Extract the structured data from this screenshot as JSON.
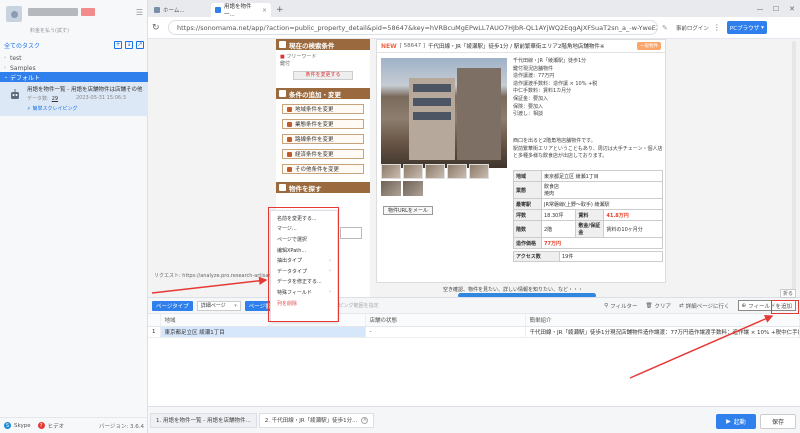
{
  "sidebar": {
    "user_sub": "料金を払う(試す)",
    "task_head_label": "全てのタスク",
    "tree": [
      {
        "label": "test"
      },
      {
        "label": "Samples"
      },
      {
        "label": "デフォルト"
      }
    ],
    "task": {
      "title": "用語を物件一覧 - 用語を店舗物件は店舗その他",
      "data_label": "データ数:",
      "data_count": "29",
      "date": "2023-05-31 15:06:3",
      "action": "簡単スクレイピング"
    },
    "footer": {
      "skype": "Skype",
      "help": "ヒデオ",
      "version": "バージョン: 3.6.4"
    }
  },
  "tabs": [
    {
      "label": "ホーム..."
    },
    {
      "label": "用語を物件一..."
    }
  ],
  "address": {
    "url": "https://sonomama.net/app/?action=public_property_detail&pid=58647&key=hVRBcuMgEPwLL7AUO7HJbR-QL1AYjWQ2EqgAJXFSuaT2sn_a_-w-YweEZMCuyg...",
    "login": "事前ログイン",
    "browser_btn": "PCブラウザ"
  },
  "webpage": {
    "cond_head": "現在の検索条件",
    "cond_line1": "フリーワード",
    "cond_line2": "鍵付",
    "cond_btn": "条件を変更する",
    "add_head": "条件の追加・変更",
    "change_btns": [
      "地域条件を変更",
      "業態条件を変更",
      "路線条件を変更",
      "経済条件を変更",
      "その他条件を変更"
    ],
    "find_head": "物件を探す",
    "new_label": "NEW",
    "property_id": "[ 58647 ]",
    "property_title": "千代田線・JR「綾瀬駅」徒歩1分 / 駅前繁華街エリア2階角地店舗物件※",
    "badge": "一般物件",
    "desc_lines": [
      "千代田線・JR「綾瀬駅」徒歩1分",
      "鍵付現況店舗物件",
      "造作讓渡：77万円",
      "造作讓渡手数料：造作讓 × 10% +税",
      "中仁手数料：賃料1カ月分",
      "保証金：要加入",
      "保険：要加入",
      "引渡し：相談"
    ],
    "desc2_lines": [
      "西口を出ると2階角地店舗物件です。",
      "駅前繁華街エリアということもあり、周辺は大手チェーン・個人店",
      "と多種多様な飲食店が出店しております。"
    ],
    "url_btn": "物件URLをメール",
    "table": {
      "area_label": "地域",
      "area_value": "東京都足立区 綾瀬1丁目",
      "biz_label": "業態",
      "biz_value1": "飲食店",
      "biz_value2": "焼肉",
      "station_label": "最寄駅",
      "station_value": "JR常磐線(上野〜取手) 綾瀬駅",
      "tsubo_label": "坪数",
      "tsubo_value": "18.30坪",
      "rent_label": "賃料",
      "rent_value": "41.8万円",
      "floor_label": "階数",
      "floor_value": "2階",
      "deposit_label": "敷金/保証金",
      "deposit_value": "賃料の10ヶ月分",
      "transfer_label": "造作価格",
      "transfer_value": "77万円",
      "access_label": "アクセス数",
      "access_value": "19件"
    },
    "bottom_text": "空き確認、物件を見たい、詳しい情報を知りたい、など・・・",
    "left_line": "リクエスト: https://analyze.pro.research-artisan.com/..."
  },
  "context_menu": {
    "items": [
      {
        "label": "名前を変更する...",
        "sub": false,
        "danger": false
      },
      {
        "label": "マージ...",
        "sub": false,
        "danger": false
      },
      {
        "label": "ページで選択",
        "sub": false,
        "danger": false
      },
      {
        "label": "编辑XPath...",
        "sub": false,
        "danger": false
      },
      {
        "label": "抽出タイプ",
        "sub": true,
        "danger": false
      },
      {
        "label": "データタイプ",
        "sub": true,
        "danger": false
      },
      {
        "label": "データを修正する...",
        "sub": false,
        "danger": false
      },
      {
        "label": "特殊フィールド",
        "sub": true,
        "danger": false
      },
      {
        "label": "列を削除",
        "sub": false,
        "danger": true
      }
    ]
  },
  "datapanel": {
    "page_type_btn": "ページタイプ",
    "page_type_select": "詳細ページ",
    "page_no_btn": "ページ番号",
    "crawl_label": "スクレイピング範囲を指定",
    "filter": "フィルター",
    "clear": "クリア",
    "detail_go": "詳細ページに行く",
    "add_field": "フィールドを追加",
    "back_top": "折る",
    "columns": [
      "地域",
      "店舗の状態",
      "簡単紹介"
    ],
    "rows": [
      {
        "no": "1",
        "area": "東京都足立区 綾瀬1丁目",
        "status": "-",
        "intro": "千代田線・JR「綾瀬駅」徒歩1分現況店舗物件造作讓渡：77万円造作讓渡手数料：造作讓 × 10% +税中仁手数料：賃料1カ月分..."
      }
    ]
  },
  "bottom": {
    "tabs": [
      {
        "label": "1. 用語を物件一覧 - 用語を店舗物件..."
      },
      {
        "label": "2. 千代田線・JR「綾瀬駅」徒歩1分..."
      }
    ],
    "start": "起動",
    "save": "保存"
  }
}
